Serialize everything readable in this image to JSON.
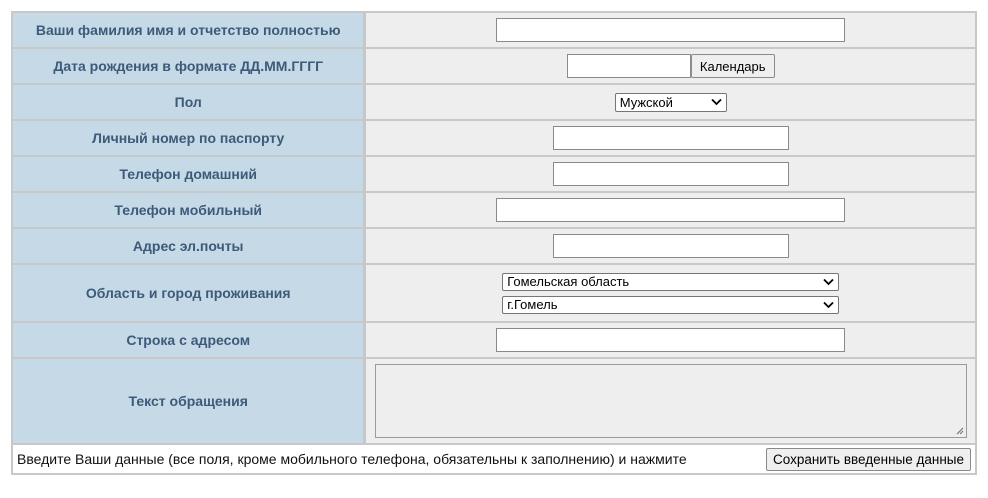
{
  "form": {
    "rows": {
      "fullname": {
        "label": "Ваши фамилия имя и отчетство полностью",
        "value": ""
      },
      "birthdate": {
        "label": "Дата рождения в формате ДД.ММ.ГГГГ",
        "value": "",
        "calendar_button": "Календарь"
      },
      "gender": {
        "label": "Пол",
        "selected": "Мужской"
      },
      "passport": {
        "label": "Личный номер по паспорту",
        "value": ""
      },
      "home_phone": {
        "label": "Телефон домашний",
        "value": ""
      },
      "mobile_phone": {
        "label": "Телефон мобильный",
        "value": ""
      },
      "email": {
        "label": "Адрес эл.почты",
        "value": ""
      },
      "region_city": {
        "label": "Область и город проживания",
        "region_selected": "Гомельская область",
        "city_selected": "г.Гомель"
      },
      "address": {
        "label": "Строка с адресом",
        "value": ""
      },
      "message": {
        "label": "Текст обращения",
        "value": ""
      }
    },
    "footer": {
      "instruction": "Введите Ваши данные (все поля, кроме мобильного телефона, обязательны к заполнению) и нажмите",
      "save_button": "Сохранить введенные данные"
    }
  },
  "colors": {
    "label_bg": "#c5dae6",
    "label_text": "#3e5a7a",
    "field_bg": "#eeeeee",
    "grid": "#c8c8c8"
  }
}
